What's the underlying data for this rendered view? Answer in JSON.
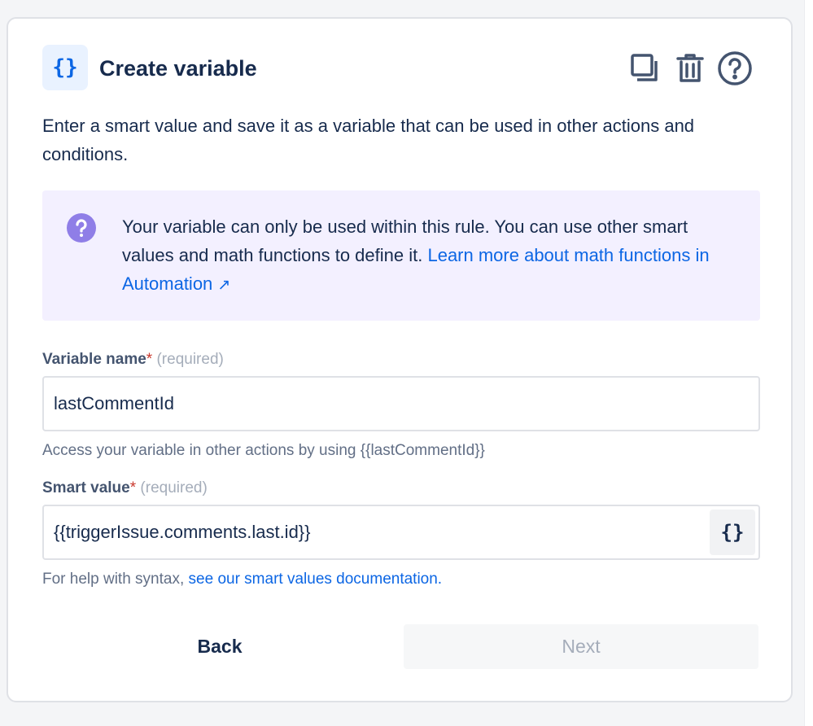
{
  "header": {
    "icon_glyph": "{}",
    "title": "Create variable",
    "icons": [
      "duplicate-icon",
      "trash-icon",
      "help-icon"
    ]
  },
  "description": "Enter a smart value and save it as a variable that can be used in other actions and conditions.",
  "info": {
    "text": "Your variable can only be used within this rule. You can use other smart values and math functions to define it.",
    "link_text": "Learn more about math functions in Automation",
    "external_glyph": "↗"
  },
  "variable_name": {
    "label": "Variable name",
    "asterisk": "*",
    "required_text": "(required)",
    "value": "lastCommentId",
    "helper": "Access your variable in other actions by using {{lastCommentId}}"
  },
  "smart_value": {
    "label": "Smart value",
    "asterisk": "*",
    "required_text": "(required)",
    "value": "{{triggerIssue.comments.last.id}}",
    "brace_button": "{}",
    "helper_prefix": "For help with syntax,",
    "helper_link": "see our smart values documentation."
  },
  "footer": {
    "back_label": "Back",
    "next_label": "Next"
  },
  "colors": {
    "accent": "#0c66e4",
    "info_bg": "#f3f0ff",
    "info_icon": "#8f7ee7",
    "required": "#c9372c"
  }
}
